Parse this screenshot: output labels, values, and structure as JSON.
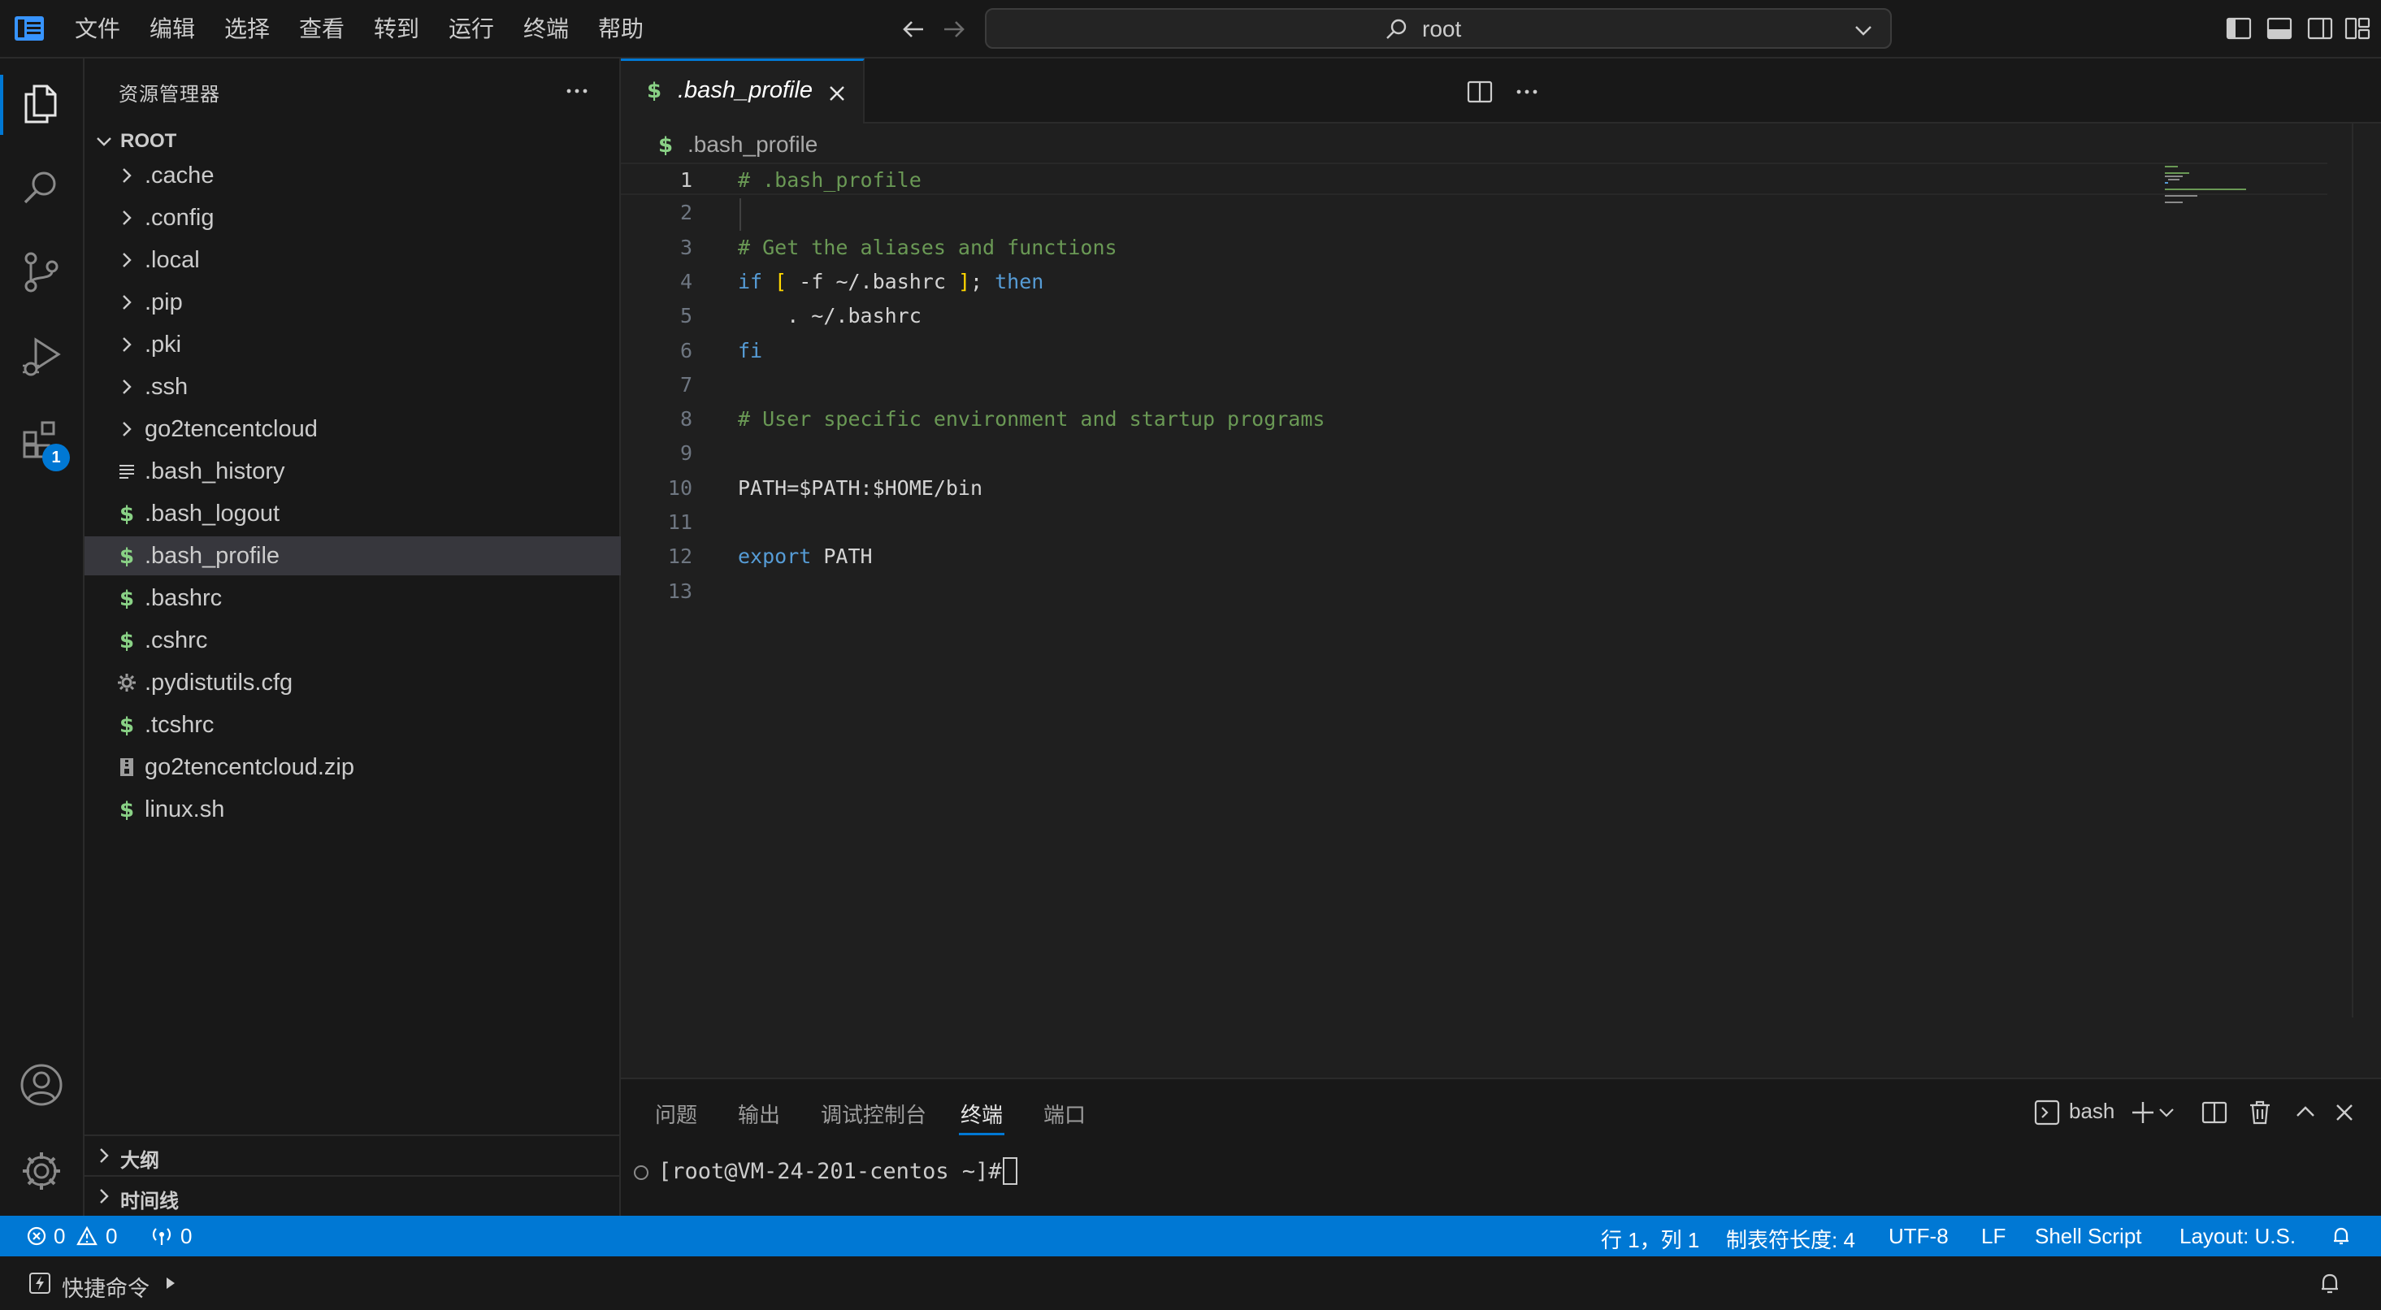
{
  "menu": [
    "文件",
    "编辑",
    "选择",
    "查看",
    "转到",
    "运行",
    "终端",
    "帮助"
  ],
  "command_center": {
    "label": "root"
  },
  "activity_bar": {
    "extensions_badge": "1"
  },
  "sidebar": {
    "title": "资源管理器",
    "root_label": "ROOT",
    "items": [
      {
        "label": ".cache",
        "icon": "chevron-right-icon",
        "kind": "folder"
      },
      {
        "label": ".config",
        "icon": "chevron-right-icon",
        "kind": "folder"
      },
      {
        "label": ".local",
        "icon": "chevron-right-icon",
        "kind": "folder"
      },
      {
        "label": ".pip",
        "icon": "chevron-right-icon",
        "kind": "folder"
      },
      {
        "label": ".pki",
        "icon": "chevron-right-icon",
        "kind": "folder"
      },
      {
        "label": ".ssh",
        "icon": "chevron-right-icon",
        "kind": "folder"
      },
      {
        "label": "go2tencentcloud",
        "icon": "chevron-right-icon",
        "kind": "folder"
      },
      {
        "label": ".bash_history",
        "icon": "text-file-icon",
        "kind": "file"
      },
      {
        "label": ".bash_logout",
        "icon": "shell-file-icon",
        "kind": "file"
      },
      {
        "label": ".bash_profile",
        "icon": "shell-file-icon",
        "kind": "file",
        "selected": true
      },
      {
        "label": ".bashrc",
        "icon": "shell-file-icon",
        "kind": "file"
      },
      {
        "label": ".cshrc",
        "icon": "shell-file-icon",
        "kind": "file"
      },
      {
        "label": ".pydistutils.cfg",
        "icon": "gear-file-icon",
        "kind": "file"
      },
      {
        "label": ".tcshrc",
        "icon": "shell-file-icon",
        "kind": "file"
      },
      {
        "label": "go2tencentcloud.zip",
        "icon": "zip-file-icon",
        "kind": "file"
      },
      {
        "label": "linux.sh",
        "icon": "shell-file-icon",
        "kind": "file"
      }
    ],
    "outline_label": "大纲",
    "timeline_label": "时间线"
  },
  "editor": {
    "tab_label": ".bash_profile",
    "breadcrumb": ".bash_profile",
    "shell_glyph": "$",
    "active_line": 1,
    "lines": [
      [
        {
          "t": "# .bash_profile",
          "c": "comment"
        }
      ],
      [],
      [
        {
          "t": "# Get the aliases and functions",
          "c": "comment"
        }
      ],
      [
        {
          "t": "if",
          "c": "keyword"
        },
        {
          "t": " ",
          "c": "text"
        },
        {
          "t": "[",
          "c": "bracket"
        },
        {
          "t": " -f ~/.bashrc ",
          "c": "text"
        },
        {
          "t": "]",
          "c": "bracket"
        },
        {
          "t": "; ",
          "c": "text"
        },
        {
          "t": "then",
          "c": "keyword"
        }
      ],
      [
        {
          "t": "    . ~/.bashrc",
          "c": "text"
        }
      ],
      [
        {
          "t": "fi",
          "c": "keyword"
        }
      ],
      [],
      [
        {
          "t": "# User specific environment and startup programs",
          "c": "comment"
        }
      ],
      [],
      [
        {
          "t": "PATH=$PATH:$HOME/bin",
          "c": "text"
        }
      ],
      [],
      [
        {
          "t": "export",
          "c": "keyword"
        },
        {
          "t": " PATH",
          "c": "text"
        }
      ],
      []
    ]
  },
  "panel": {
    "tabs": [
      "问题",
      "输出",
      "调试控制台",
      "终端",
      "端口"
    ],
    "active_tab": "终端",
    "terminal_profile": "bash",
    "prompt": "[root@VM-24-201-centos ~]# "
  },
  "statusbar": {
    "errors": "0",
    "warnings": "0",
    "ports": "0",
    "cursor_position": "行 1，列 1",
    "tab_size": "制表符长度: 4",
    "encoding": "UTF-8",
    "eol": "LF",
    "language": "Shell Script",
    "layout": "Layout: U.S."
  },
  "bottom_bar": {
    "quick_command": "快捷命令"
  },
  "colors": {
    "accent": "#0078d4",
    "shell_file_icon": "#89d185",
    "comment": "#6a9955",
    "keyword": "#569cd6"
  }
}
